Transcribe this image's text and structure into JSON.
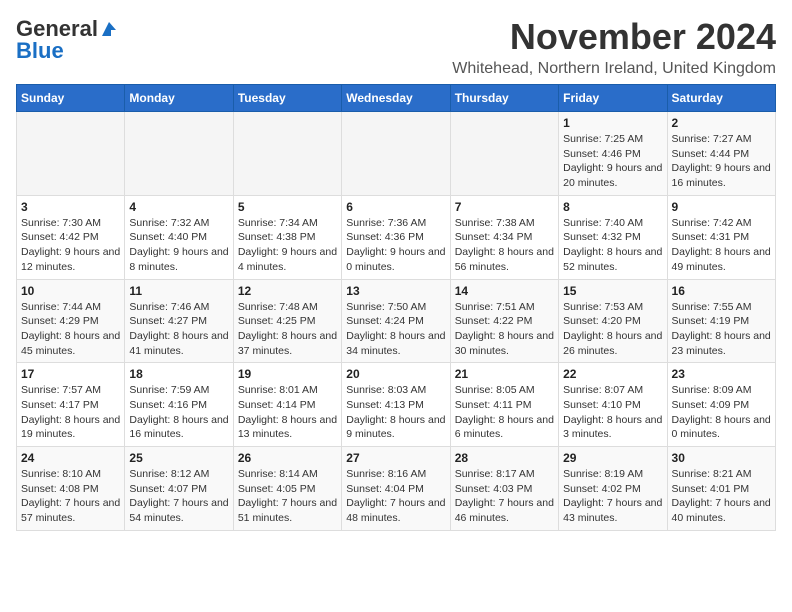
{
  "logo": {
    "general": "General",
    "blue": "Blue"
  },
  "title": "November 2024",
  "subtitle": "Whitehead, Northern Ireland, United Kingdom",
  "days_of_week": [
    "Sunday",
    "Monday",
    "Tuesday",
    "Wednesday",
    "Thursday",
    "Friday",
    "Saturday"
  ],
  "weeks": [
    [
      {
        "day": "",
        "info": ""
      },
      {
        "day": "",
        "info": ""
      },
      {
        "day": "",
        "info": ""
      },
      {
        "day": "",
        "info": ""
      },
      {
        "day": "",
        "info": ""
      },
      {
        "day": "1",
        "info": "Sunrise: 7:25 AM\nSunset: 4:46 PM\nDaylight: 9 hours and 20 minutes."
      },
      {
        "day": "2",
        "info": "Sunrise: 7:27 AM\nSunset: 4:44 PM\nDaylight: 9 hours and 16 minutes."
      }
    ],
    [
      {
        "day": "3",
        "info": "Sunrise: 7:30 AM\nSunset: 4:42 PM\nDaylight: 9 hours and 12 minutes."
      },
      {
        "day": "4",
        "info": "Sunrise: 7:32 AM\nSunset: 4:40 PM\nDaylight: 9 hours and 8 minutes."
      },
      {
        "day": "5",
        "info": "Sunrise: 7:34 AM\nSunset: 4:38 PM\nDaylight: 9 hours and 4 minutes."
      },
      {
        "day": "6",
        "info": "Sunrise: 7:36 AM\nSunset: 4:36 PM\nDaylight: 9 hours and 0 minutes."
      },
      {
        "day": "7",
        "info": "Sunrise: 7:38 AM\nSunset: 4:34 PM\nDaylight: 8 hours and 56 minutes."
      },
      {
        "day": "8",
        "info": "Sunrise: 7:40 AM\nSunset: 4:32 PM\nDaylight: 8 hours and 52 minutes."
      },
      {
        "day": "9",
        "info": "Sunrise: 7:42 AM\nSunset: 4:31 PM\nDaylight: 8 hours and 49 minutes."
      }
    ],
    [
      {
        "day": "10",
        "info": "Sunrise: 7:44 AM\nSunset: 4:29 PM\nDaylight: 8 hours and 45 minutes."
      },
      {
        "day": "11",
        "info": "Sunrise: 7:46 AM\nSunset: 4:27 PM\nDaylight: 8 hours and 41 minutes."
      },
      {
        "day": "12",
        "info": "Sunrise: 7:48 AM\nSunset: 4:25 PM\nDaylight: 8 hours and 37 minutes."
      },
      {
        "day": "13",
        "info": "Sunrise: 7:50 AM\nSunset: 4:24 PM\nDaylight: 8 hours and 34 minutes."
      },
      {
        "day": "14",
        "info": "Sunrise: 7:51 AM\nSunset: 4:22 PM\nDaylight: 8 hours and 30 minutes."
      },
      {
        "day": "15",
        "info": "Sunrise: 7:53 AM\nSunset: 4:20 PM\nDaylight: 8 hours and 26 minutes."
      },
      {
        "day": "16",
        "info": "Sunrise: 7:55 AM\nSunset: 4:19 PM\nDaylight: 8 hours and 23 minutes."
      }
    ],
    [
      {
        "day": "17",
        "info": "Sunrise: 7:57 AM\nSunset: 4:17 PM\nDaylight: 8 hours and 19 minutes."
      },
      {
        "day": "18",
        "info": "Sunrise: 7:59 AM\nSunset: 4:16 PM\nDaylight: 8 hours and 16 minutes."
      },
      {
        "day": "19",
        "info": "Sunrise: 8:01 AM\nSunset: 4:14 PM\nDaylight: 8 hours and 13 minutes."
      },
      {
        "day": "20",
        "info": "Sunrise: 8:03 AM\nSunset: 4:13 PM\nDaylight: 8 hours and 9 minutes."
      },
      {
        "day": "21",
        "info": "Sunrise: 8:05 AM\nSunset: 4:11 PM\nDaylight: 8 hours and 6 minutes."
      },
      {
        "day": "22",
        "info": "Sunrise: 8:07 AM\nSunset: 4:10 PM\nDaylight: 8 hours and 3 minutes."
      },
      {
        "day": "23",
        "info": "Sunrise: 8:09 AM\nSunset: 4:09 PM\nDaylight: 8 hours and 0 minutes."
      }
    ],
    [
      {
        "day": "24",
        "info": "Sunrise: 8:10 AM\nSunset: 4:08 PM\nDaylight: 7 hours and 57 minutes."
      },
      {
        "day": "25",
        "info": "Sunrise: 8:12 AM\nSunset: 4:07 PM\nDaylight: 7 hours and 54 minutes."
      },
      {
        "day": "26",
        "info": "Sunrise: 8:14 AM\nSunset: 4:05 PM\nDaylight: 7 hours and 51 minutes."
      },
      {
        "day": "27",
        "info": "Sunrise: 8:16 AM\nSunset: 4:04 PM\nDaylight: 7 hours and 48 minutes."
      },
      {
        "day": "28",
        "info": "Sunrise: 8:17 AM\nSunset: 4:03 PM\nDaylight: 7 hours and 46 minutes."
      },
      {
        "day": "29",
        "info": "Sunrise: 8:19 AM\nSunset: 4:02 PM\nDaylight: 7 hours and 43 minutes."
      },
      {
        "day": "30",
        "info": "Sunrise: 8:21 AM\nSunset: 4:01 PM\nDaylight: 7 hours and 40 minutes."
      }
    ]
  ]
}
